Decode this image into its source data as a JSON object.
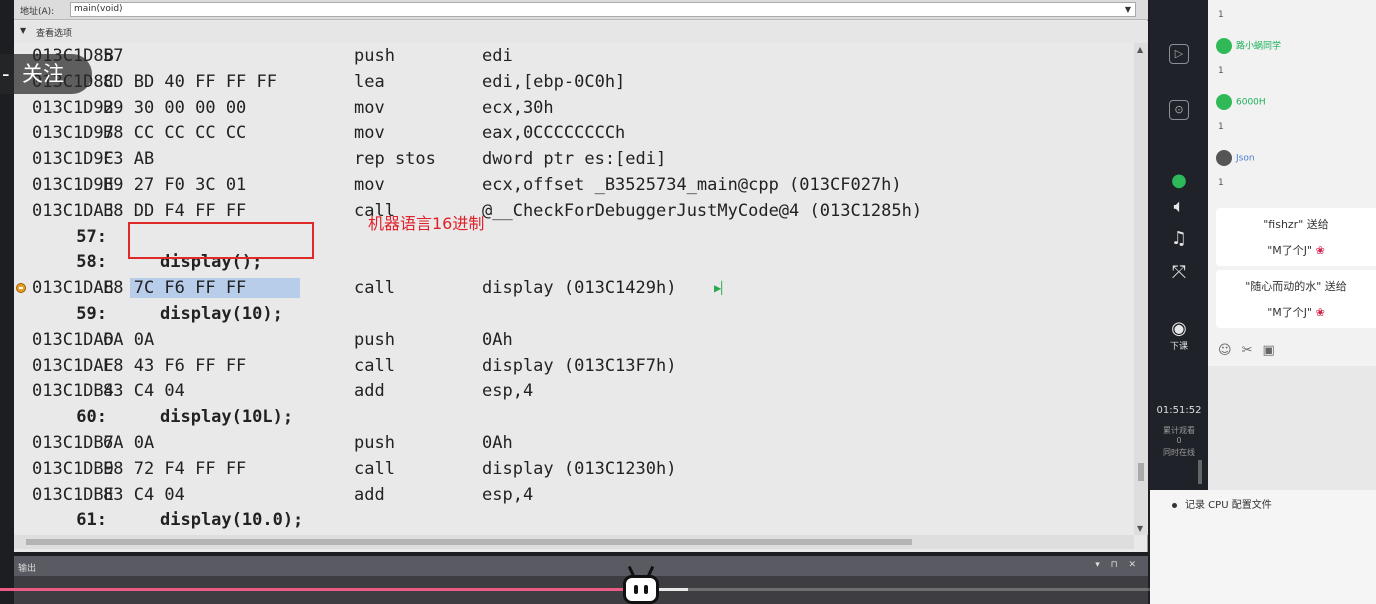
{
  "address_bar": {
    "label": "地址(A):",
    "value": "main(void)"
  },
  "view_options": "查看选项",
  "disassembly": [
    {
      "kind": "asm",
      "addr": "013C1D8B",
      "bytes": "57",
      "op": "push",
      "arg": "edi"
    },
    {
      "kind": "asm",
      "addr": "013C1D8C",
      "bytes": "8D BD 40 FF FF FF",
      "op": "lea",
      "arg": "edi,[ebp-0C0h]"
    },
    {
      "kind": "asm",
      "addr": "013C1D92",
      "bytes": "B9 30 00 00 00",
      "op": "mov",
      "arg": "ecx,30h"
    },
    {
      "kind": "asm",
      "addr": "013C1D97",
      "bytes": "B8 CC CC CC CC",
      "op": "mov",
      "arg": "eax,0CCCCCCCCh"
    },
    {
      "kind": "asm",
      "addr": "013C1D9C",
      "bytes": "F3 AB",
      "op": "rep stos",
      "arg": "dword ptr es:[edi]"
    },
    {
      "kind": "asm",
      "addr": "013C1D9E",
      "bytes": "B9 27 F0 3C 01",
      "op": "mov",
      "arg": "ecx,offset _B3525734_main@cpp (013CF027h)"
    },
    {
      "kind": "asm",
      "addr": "013C1DA3",
      "bytes": "E8 DD F4 FF FF",
      "op": "call",
      "arg": "@__CheckForDebuggerJustMyCode@4 (013C1285h)"
    },
    {
      "kind": "src",
      "num": "57:",
      "text": ""
    },
    {
      "kind": "src",
      "num": "58:",
      "text": "display();"
    },
    {
      "kind": "asm",
      "addr": "013C1DA8",
      "bytes": "E8 7C F6 FF FF",
      "op": "call",
      "arg": "display (013C1429h)",
      "selected": true
    },
    {
      "kind": "src",
      "num": "59:",
      "text": "display(10);"
    },
    {
      "kind": "asm",
      "addr": "013C1DAD",
      "bytes": "6A 0A",
      "op": "push",
      "arg": "0Ah"
    },
    {
      "kind": "asm",
      "addr": "013C1DAF",
      "bytes": "E8 43 F6 FF FF",
      "op": "call",
      "arg": "display (013C13F7h)"
    },
    {
      "kind": "asm",
      "addr": "013C1DB4",
      "bytes": "83 C4 04",
      "op": "add",
      "arg": "esp,4"
    },
    {
      "kind": "src",
      "num": "60:",
      "text": "display(10L);"
    },
    {
      "kind": "asm",
      "addr": "013C1DB7",
      "bytes": "6A 0A",
      "op": "push",
      "arg": "0Ah"
    },
    {
      "kind": "asm",
      "addr": "013C1DB9",
      "bytes": "E8 72 F4 FF FF",
      "op": "call",
      "arg": "display (013C1230h)"
    },
    {
      "kind": "asm",
      "addr": "013C1DBE",
      "bytes": "83 C4 04",
      "op": "add",
      "arg": "esp,4"
    },
    {
      "kind": "src",
      "num": "61:",
      "text": "display(10.0);"
    }
  ],
  "annotation": "机器语言16进制",
  "output_panel": {
    "title": "输出"
  },
  "video": {
    "follow_label": "关注",
    "progress_fraction": 0.465
  },
  "live_toolbar": {
    "items": [
      "下课"
    ],
    "time": "01:51:52",
    "stats": [
      "累计观看",
      "0",
      "同时在线"
    ]
  },
  "chat": {
    "messages": [
      {
        "user": "路小蜗同学",
        "count": "1"
      },
      {
        "user": "6000H",
        "count": "1"
      },
      {
        "user": "Json",
        "count": "1"
      }
    ],
    "gifts": [
      {
        "from": "\"fishzr\" 送给",
        "to": "\"M了个J\""
      },
      {
        "from": "\"随心而动的水\" 送给",
        "to": "\"M了个J\""
      }
    ],
    "top_count": "1"
  },
  "cpu_panel": {
    "item": "记录 CPU 配置文件"
  },
  "colors": {
    "highlight_box": "#e02a2a",
    "selection": "#b7cdea",
    "progress": "#ee5a86"
  }
}
